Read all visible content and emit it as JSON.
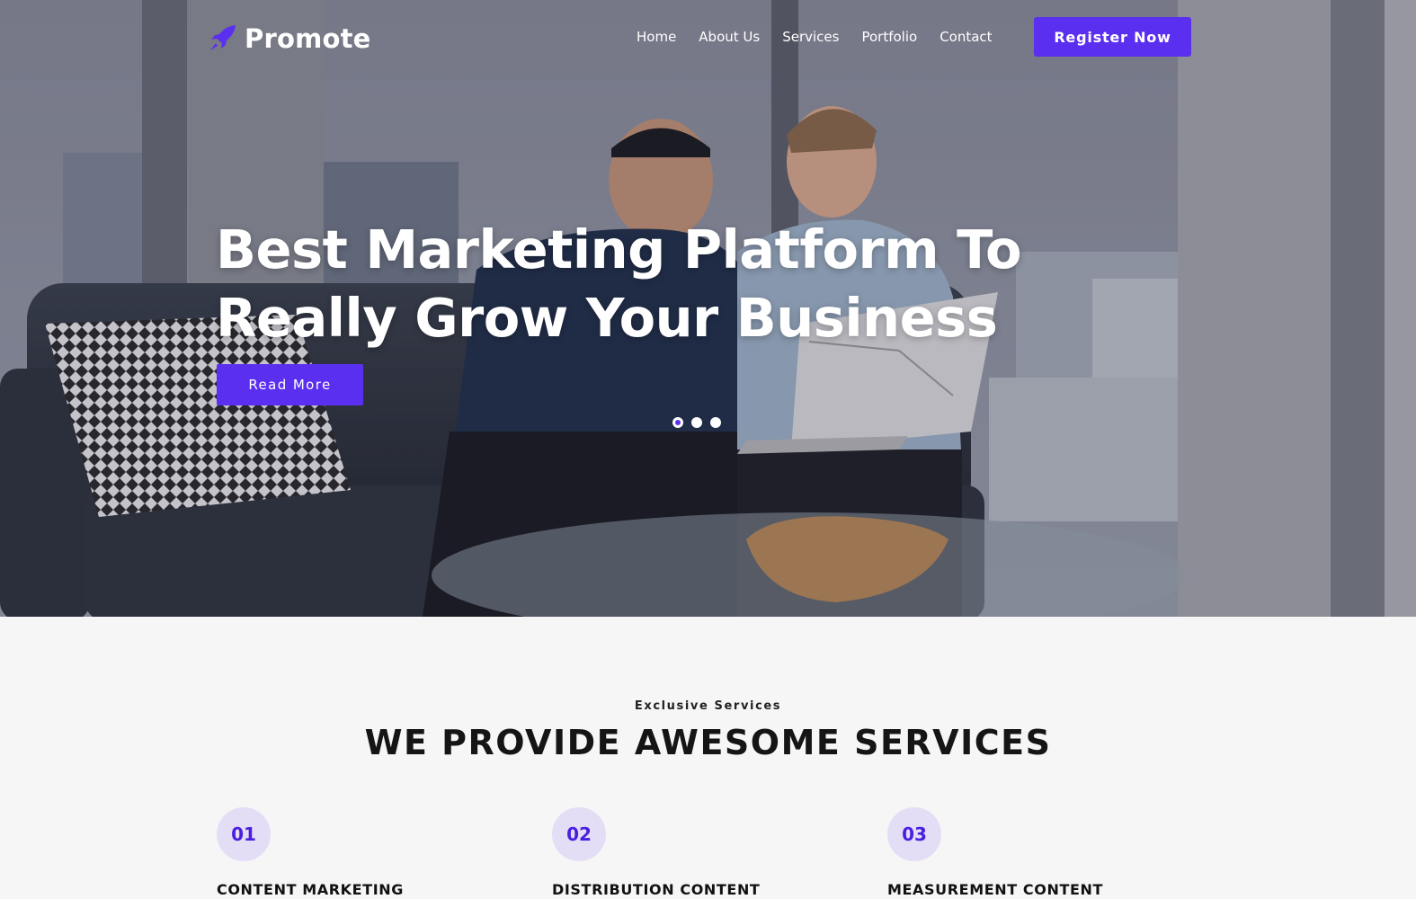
{
  "brand": {
    "name": "Promote",
    "accent": "#5b2ff0"
  },
  "nav": {
    "items": [
      "Home",
      "About Us",
      "Services",
      "Portfolio",
      "Contact"
    ],
    "cta": "Register Now"
  },
  "hero": {
    "title_line1": "Best Marketing Platform To",
    "title_line2": "Really Grow Your Business",
    "button": "Read More",
    "slides": 3,
    "active_slide": 1
  },
  "services": {
    "eyebrow": "Exclusive Services",
    "title": "WE PROVIDE AWESOME SERVICES",
    "items": [
      {
        "number": "01",
        "label": "CONTENT MARKETING"
      },
      {
        "number": "02",
        "label": "DISTRIBUTION CONTENT"
      },
      {
        "number": "03",
        "label": "MEASUREMENT CONTENT"
      }
    ]
  }
}
